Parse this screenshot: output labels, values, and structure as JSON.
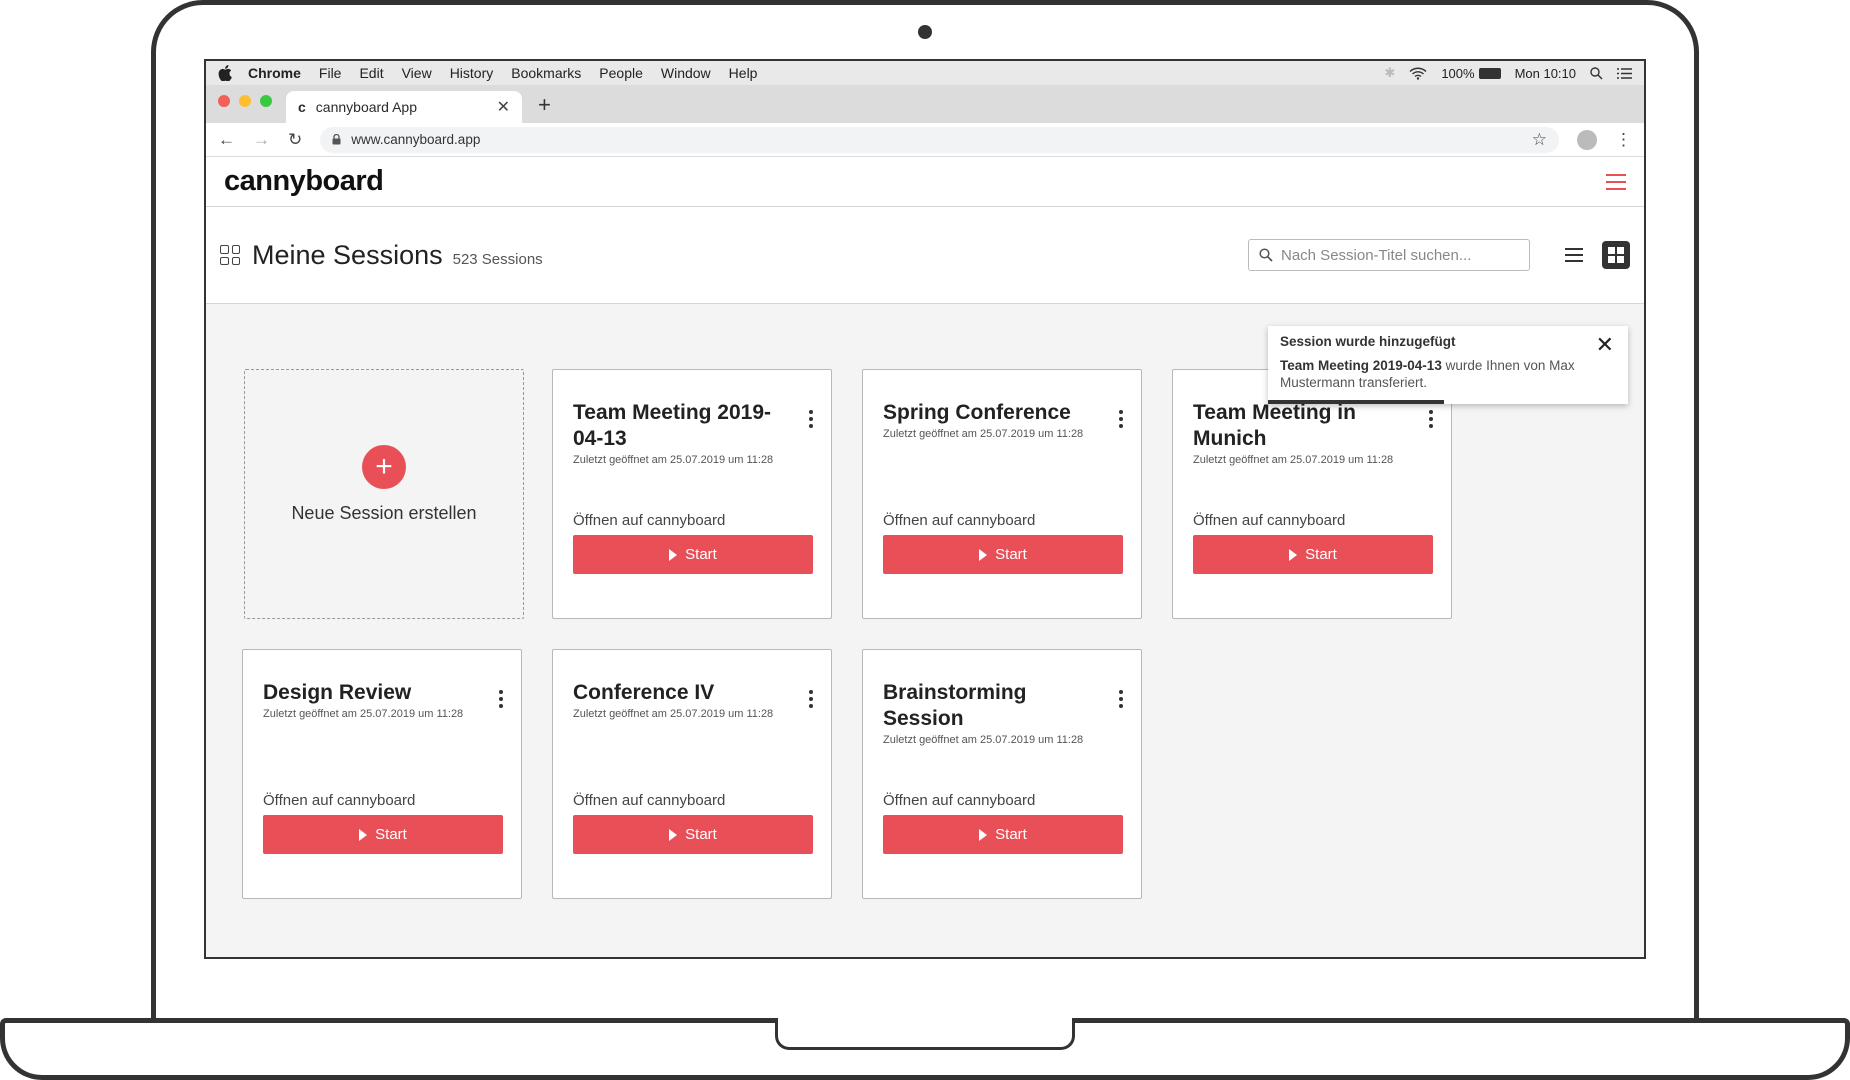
{
  "mac_menu": {
    "app": "Chrome",
    "items": [
      "File",
      "Edit",
      "View",
      "History",
      "Bookmarks",
      "People",
      "Window",
      "Help"
    ],
    "battery": "100%",
    "clock": "Mon 10:10"
  },
  "browser": {
    "tab_title": "cannyboard App",
    "tab_favicon": "c",
    "url": "www.cannyboard.app"
  },
  "app": {
    "logo": "cannyboard",
    "accent_color": "#e84f57"
  },
  "page": {
    "title": "Meine Sessions",
    "count": "523 Sessions",
    "search_placeholder": "Nach Session-Titel suchen..."
  },
  "new_session": {
    "label": "Neue Session erstellen"
  },
  "sessions": [
    {
      "title": "Team Meeting 2019-04-13",
      "meta": "Zuletzt geöffnet am 25.07.2019 um 11:28",
      "open_label": "Öffnen auf cannyboard",
      "start_label": "Start"
    },
    {
      "title": "Spring Conference",
      "meta": "Zuletzt geöffnet am 25.07.2019 um 11:28",
      "open_label": "Öffnen auf cannyboard",
      "start_label": "Start"
    },
    {
      "title": "Team Meeting in Munich",
      "meta": "Zuletzt geöffnet am 25.07.2019 um 11:28",
      "open_label": "Öffnen auf cannyboard",
      "start_label": "Start"
    },
    {
      "title": "Design Review",
      "meta": "Zuletzt geöffnet am 25.07.2019 um 11:28",
      "open_label": "Öffnen auf cannyboard",
      "start_label": "Start"
    },
    {
      "title": "Conference IV",
      "meta": "Zuletzt geöffnet am 25.07.2019 um 11:28",
      "open_label": "Öffnen auf cannyboard",
      "start_label": "Start"
    },
    {
      "title": "Brainstorming Session",
      "meta": "Zuletzt geöffnet am 25.07.2019 um 11:28",
      "open_label": "Öffnen auf cannyboard",
      "start_label": "Start"
    }
  ],
  "toast": {
    "title": "Session wurde hinzugefügt",
    "session_name": "Team Meeting 2019-04-13",
    "message": " wurde Ihnen von Max Mustermann transferiert.",
    "progress": 0.49
  }
}
